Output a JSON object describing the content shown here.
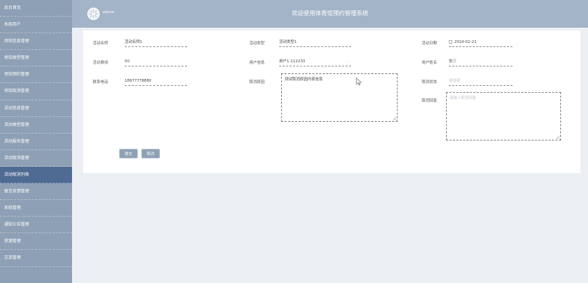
{
  "sidebar": {
    "items": [
      {
        "label": "后台首页"
      },
      {
        "label": "系统用户"
      },
      {
        "label": "场馆信息管理"
      },
      {
        "label": "场馆类型管理"
      },
      {
        "label": "场馆预约管理"
      },
      {
        "label": "场馆取消管理"
      },
      {
        "label": "活动信息管理"
      },
      {
        "label": "活动类型管理"
      },
      {
        "label": "活动报名管理"
      },
      {
        "label": "活动取消管理"
      },
      {
        "label": "活动取消列表"
      },
      {
        "label": "留言反馈管理"
      },
      {
        "label": "系统管理"
      },
      {
        "label": "通知公告管理"
      },
      {
        "label": "资源管理"
      },
      {
        "label": "交流管理"
      }
    ],
    "active_index": 10
  },
  "header": {
    "user": "admin",
    "title": "欢迎使用体育馆预约管理系统"
  },
  "form": {
    "activity_name": {
      "label": "活动名称",
      "value": "活动名称1"
    },
    "activity_type": {
      "label": "活动类型",
      "value": "活动类型1"
    },
    "activity_date": {
      "label": "活动日期",
      "value": "2024-02-21"
    },
    "activity_fee": {
      "label": "活动费用",
      "value": "50"
    },
    "user_info": {
      "label": "用户信息",
      "value": "用户1-112233"
    },
    "user_name": {
      "label": "用户姓名",
      "value": "张三"
    },
    "phone": {
      "label": "联系电话",
      "value": "18977778880"
    },
    "cancel_reason": {
      "label": "取消原因",
      "value": "测试取消原因内容信息"
    },
    "cancel_status": {
      "label": "取消状态",
      "placeholder": "请选择"
    },
    "cancel_reply": {
      "label": "取消回复",
      "placeholder": "请输入取消回复"
    },
    "submit_label": "提交",
    "cancel_label": "取消"
  },
  "colors": {
    "sidebar_bg": "#8ea0b5",
    "sidebar_active": "#4f6b94",
    "header_bg": "#a3b3c8",
    "content_bg": "#eceff4",
    "button_bg": "#8ea0b5"
  }
}
